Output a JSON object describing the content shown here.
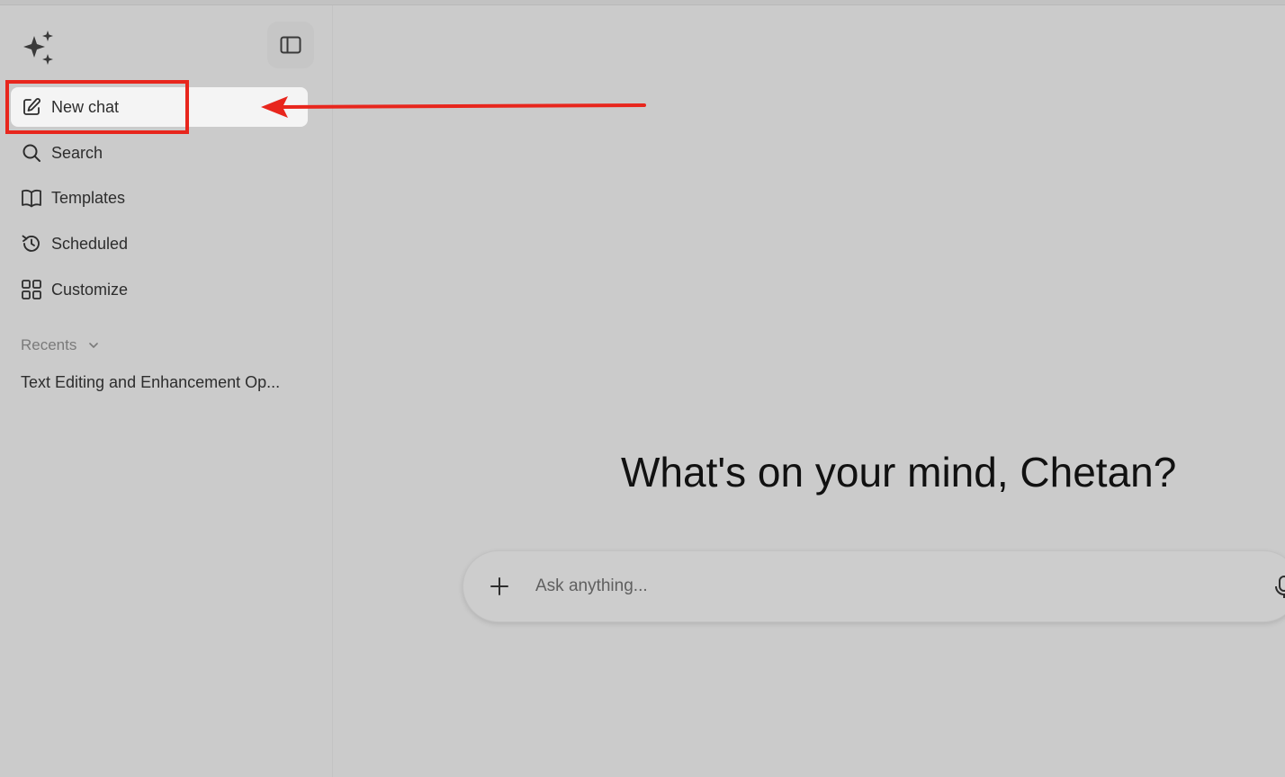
{
  "sidebar": {
    "logo_icon": "sparkles-icon",
    "toggle_icon": "sidebar-toggle-icon",
    "items": [
      {
        "label": "New chat",
        "icon": "edit-icon"
      },
      {
        "label": "Search",
        "icon": "search-icon"
      },
      {
        "label": "Templates",
        "icon": "book-icon"
      },
      {
        "label": "Scheduled",
        "icon": "clock-refresh-icon"
      },
      {
        "label": "Customize",
        "icon": "grid-icon"
      }
    ],
    "recents_label": "Recents",
    "recents": [
      "Text Editing and Enhancement Op..."
    ]
  },
  "main": {
    "greeting": "What's on your mind, Chetan?",
    "composer": {
      "placeholder": "Ask anything..."
    }
  },
  "annotation": {
    "highlight_color": "#e8261d"
  }
}
